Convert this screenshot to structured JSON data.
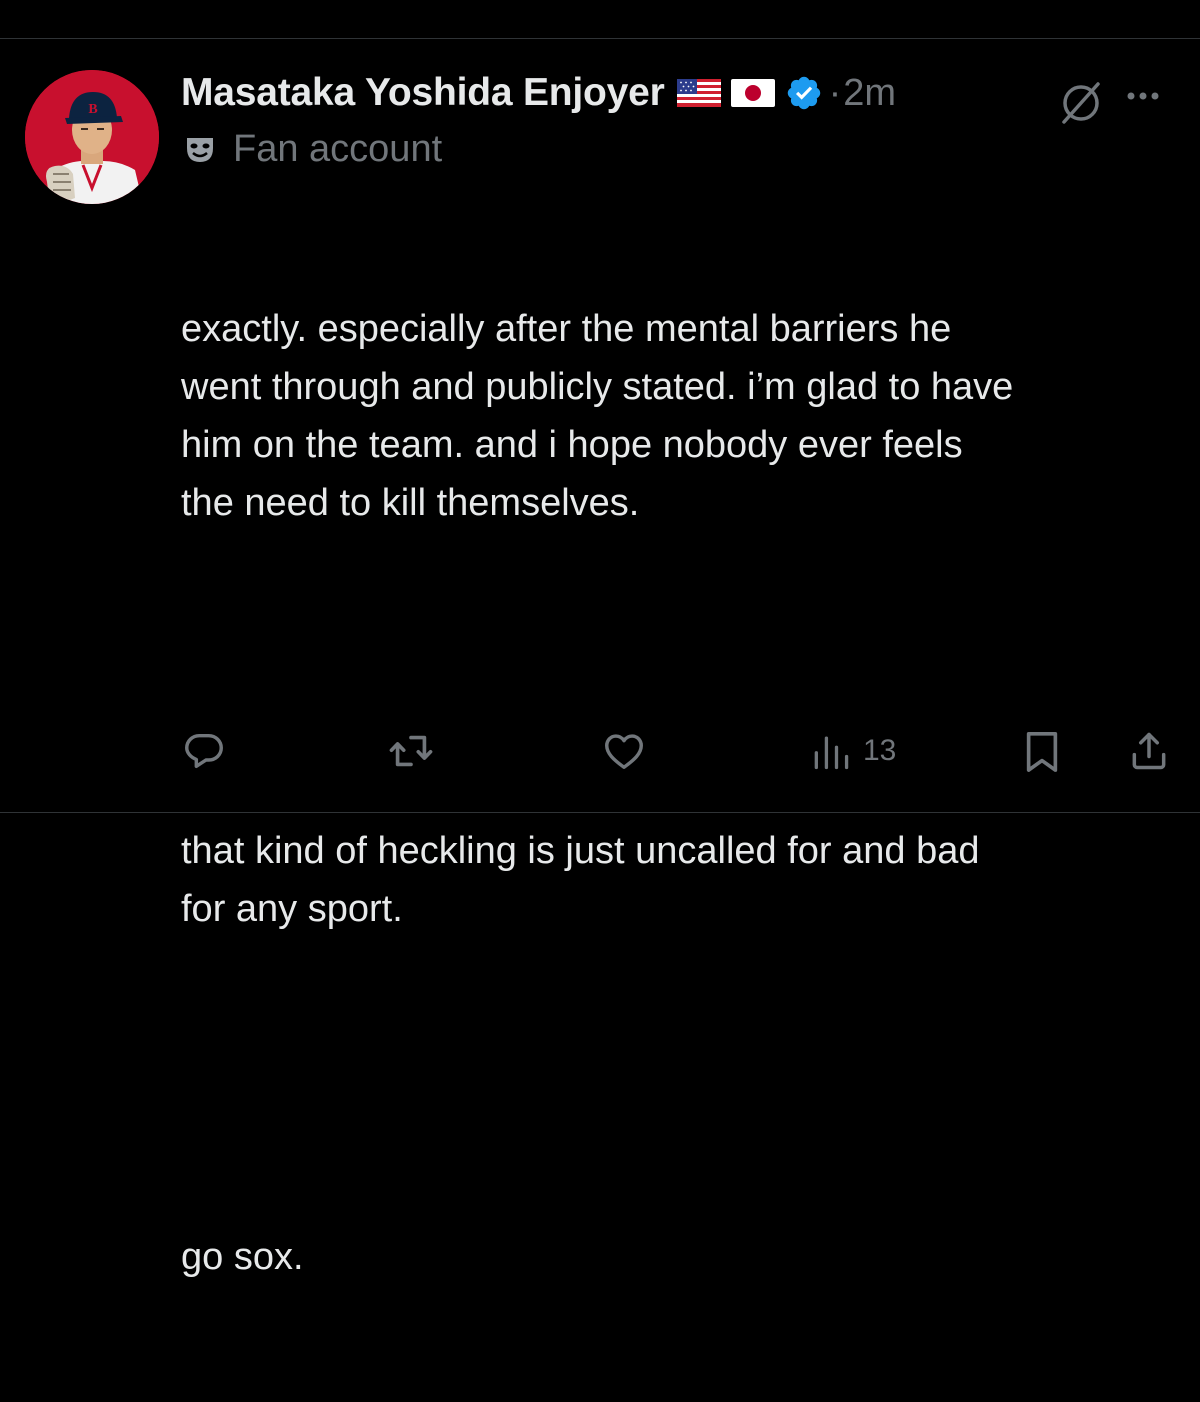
{
  "tweet": {
    "display_name": "Masataka Yoshida Enjoyer",
    "flags": [
      "us-flag-icon",
      "japan-flag-icon"
    ],
    "verified_icon": "verified-badge-icon",
    "separator": "·",
    "timestamp": "2m",
    "label_icon": "theater-masks-icon",
    "label_text": "Fan account",
    "paragraphs": [
      "exactly. especially after the mental barriers he\nwent through and publicly stated. i’m glad to have\nhim on the team. and i hope nobody ever feels\nthe need to kill themselves.",
      "that kind of heckling is just uncalled for and bad\nfor any sport.",
      "go sox."
    ],
    "views_count": "13"
  },
  "actions": [
    "reply-icon",
    "retweet-icon",
    "like-icon",
    "views-icon",
    "bookmark-icon",
    "share-icon"
  ],
  "colors": {
    "background": "#000000",
    "text": "#e7e9ea",
    "secondary": "#71767b",
    "verified": "#1d9bf0",
    "divider": "#2f3336"
  }
}
